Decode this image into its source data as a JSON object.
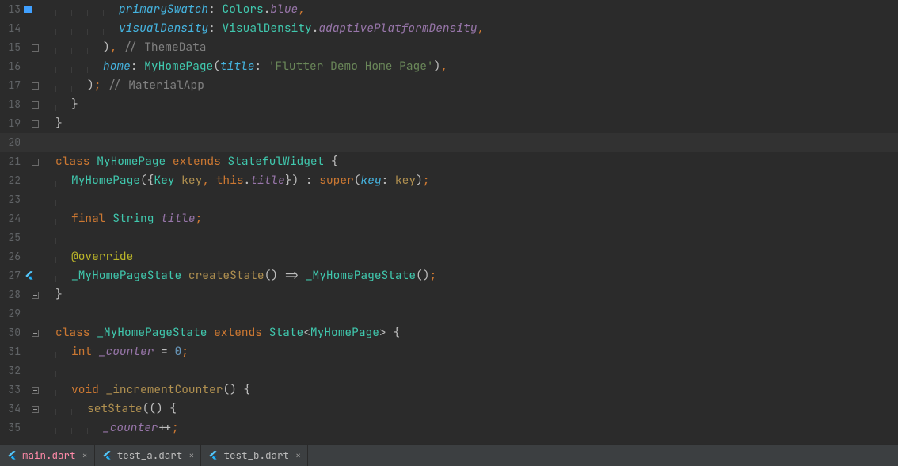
{
  "lines": {
    "l13": "13",
    "l14": "14",
    "l15": "15",
    "l16": "16",
    "l17": "17",
    "l18": "18",
    "l19": "19",
    "l20": "20",
    "l21": "21",
    "l22": "22",
    "l23": "23",
    "l24": "24",
    "l25": "25",
    "l26": "26",
    "l27": "27",
    "l28": "28",
    "l29": "29",
    "l30": "30",
    "l31": "31",
    "l32": "32",
    "l33": "33",
    "l34": "34",
    "l35": "35"
  },
  "code": {
    "l13": {
      "lbl": "primarySwatch",
      "colors": "Colors",
      "dot": ".",
      "blue": "blue",
      "comma": ","
    },
    "l14": {
      "lbl": "visualDensity",
      "vd": "VisualDensity",
      "dot": ".",
      "apd": "adaptivePlatformDensity",
      "comma": ","
    },
    "l15": {
      "close": ")",
      "comma": ",",
      "cmt": " // ThemeData"
    },
    "l16": {
      "home": "home",
      "colon": ": ",
      "cls": "MyHomePage",
      "open": "(",
      "title": "title",
      "colon2": ": ",
      "str": "'Flutter Demo Home Page'",
      "close": ")",
      "comma": ","
    },
    "l17": {
      "close": ")",
      "semi": ";",
      "cmt": " // MaterialApp"
    },
    "l18": {
      "brace": "}"
    },
    "l19": {
      "brace": "}"
    },
    "l21": {
      "kw1": "class ",
      "cls": "MyHomePage",
      "kw2": " extends ",
      "base": "StatefulWidget",
      "brace": " {"
    },
    "l22": {
      "ctor": "MyHomePage",
      "open": "({",
      "keycls": "Key",
      "sp": " ",
      "keyvar": "key",
      "comma": ", ",
      "this": "this",
      "dot": ".",
      "title": "title",
      "close": "})",
      "colon": " : ",
      "super": "super",
      "open2": "(",
      "keylbl": "key",
      "colon2": ": ",
      "keyvar2": "key",
      "close2": ")",
      "semi": ";"
    },
    "l24": {
      "final": "final ",
      "string": "String",
      "sp": " ",
      "title": "title",
      "semi": ";"
    },
    "l26": {
      "ann": "@override"
    },
    "l27": {
      "state": "_MyHomePageState",
      "sp": " ",
      "create": "createState",
      "par": "()",
      "arrow": " => ",
      "state2": "_MyHomePageState",
      "par2": "()",
      "semi": ";"
    },
    "l28": {
      "brace": "}"
    },
    "l30": {
      "kw1": "class ",
      "cls": "_MyHomePageState",
      "kw2": " extends ",
      "base": "State",
      "lt": "<",
      "param": "MyHomePage",
      "gt": ">",
      "brace": " {"
    },
    "l31": {
      "int": "int ",
      "counter": "_counter",
      "eq": " = ",
      "zero": "0",
      "semi": ";"
    },
    "l33": {
      "void": "void ",
      "fn": "_incrementCounter",
      "par": "()",
      "brace": " {"
    },
    "l34": {
      "set": "setState",
      "open": "((",
      "close": ")",
      "brace": " {"
    },
    "l35": {
      "counter": "_counter",
      "pp": "++",
      "semi": ";"
    }
  },
  "tabs": {
    "t1": "main.dart",
    "t2": "test_a.dart",
    "t3": "test_b.dart",
    "close": "×"
  }
}
